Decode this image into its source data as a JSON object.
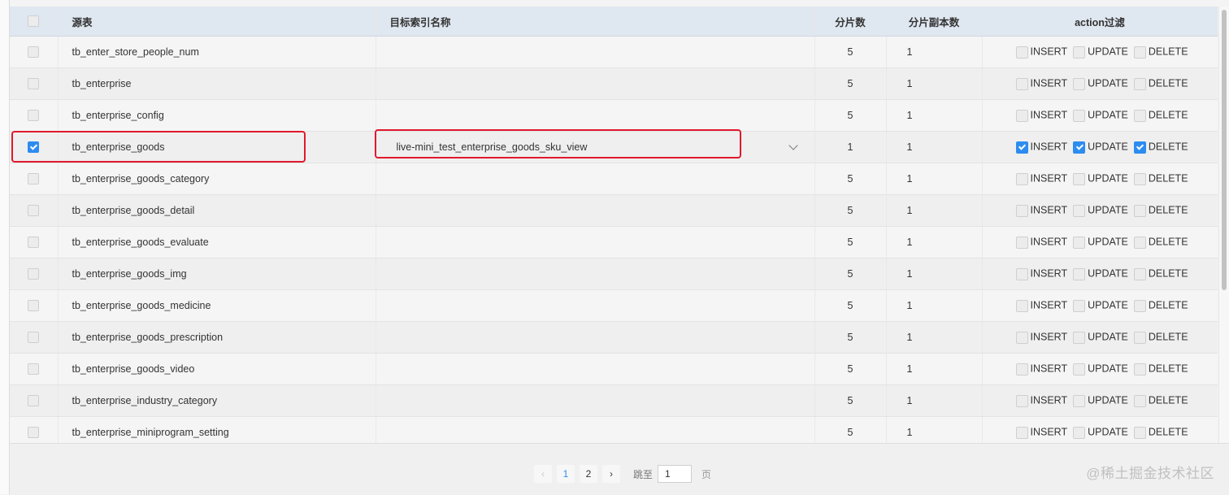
{
  "table": {
    "columns": {
      "source": "源表",
      "target_index": "目标索引名称",
      "shards": "分片数",
      "replicas": "分片副本数",
      "action_filter": "action过滤"
    },
    "action_labels": {
      "insert": "INSERT",
      "update": "UPDATE",
      "delete": "DELETE"
    },
    "rows": [
      {
        "source": "tb_enter_store_people_num",
        "target": "",
        "shards": "5",
        "replicas": "1",
        "checked": false
      },
      {
        "source": "tb_enterprise",
        "target": "",
        "shards": "5",
        "replicas": "1",
        "checked": false
      },
      {
        "source": "tb_enterprise_config",
        "target": "",
        "shards": "5",
        "replicas": "1",
        "checked": false
      },
      {
        "source": "tb_enterprise_goods",
        "target": "live-mini_test_enterprise_goods_sku_view",
        "shards": "1",
        "replicas": "1",
        "checked": true
      },
      {
        "source": "tb_enterprise_goods_category",
        "target": "",
        "shards": "5",
        "replicas": "1",
        "checked": false
      },
      {
        "source": "tb_enterprise_goods_detail",
        "target": "",
        "shards": "5",
        "replicas": "1",
        "checked": false
      },
      {
        "source": "tb_enterprise_goods_evaluate",
        "target": "",
        "shards": "5",
        "replicas": "1",
        "checked": false
      },
      {
        "source": "tb_enterprise_goods_img",
        "target": "",
        "shards": "5",
        "replicas": "1",
        "checked": false
      },
      {
        "source": "tb_enterprise_goods_medicine",
        "target": "",
        "shards": "5",
        "replicas": "1",
        "checked": false
      },
      {
        "source": "tb_enterprise_goods_prescription",
        "target": "",
        "shards": "5",
        "replicas": "1",
        "checked": false
      },
      {
        "source": "tb_enterprise_goods_video",
        "target": "",
        "shards": "5",
        "replicas": "1",
        "checked": false
      },
      {
        "source": "tb_enterprise_industry_category",
        "target": "",
        "shards": "5",
        "replicas": "1",
        "checked": false
      },
      {
        "source": "tb_enterprise_miniprogram_setting",
        "target": "",
        "shards": "5",
        "replicas": "1",
        "checked": false
      }
    ]
  },
  "pagination": {
    "prev_icon": "chevron-left-icon",
    "next_icon": "chevron-right-icon",
    "pages": [
      "1",
      "2"
    ],
    "current_page": "1",
    "jump_label": "跳至",
    "jump_value": "1",
    "page_unit": "页"
  },
  "watermark": "@稀土掘金技术社区",
  "colors": {
    "accent": "#2d8cf0",
    "highlight": "#e0192d",
    "header_bg": "#dfe7f0"
  }
}
